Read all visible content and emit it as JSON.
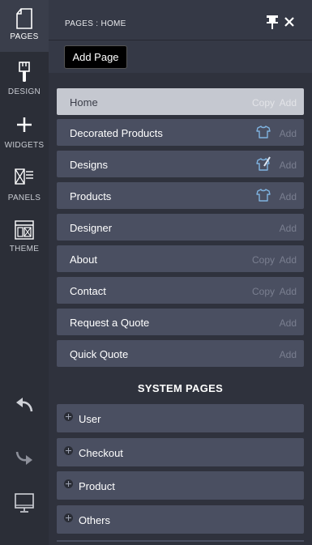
{
  "rail": {
    "items": [
      {
        "label": "PAGES",
        "icon": "page-icon"
      },
      {
        "label": "DESIGN",
        "icon": "brush-icon"
      },
      {
        "label": "WIDGETS",
        "icon": "plus-icon"
      },
      {
        "label": "PANELS",
        "icon": "panels-icon"
      },
      {
        "label": "THEME",
        "icon": "theme-icon"
      }
    ],
    "bottom": [
      "undo-icon",
      "redo-icon",
      "monitor-icon"
    ]
  },
  "panel": {
    "title": "PAGES : HOME",
    "add_page_label": "Add Page",
    "pages": [
      {
        "name": "Home",
        "copy": "Copy",
        "add": "Add",
        "selected": true
      },
      {
        "name": "Decorated Products",
        "add": "Add",
        "icon": "tshirt-icon"
      },
      {
        "name": "Designs",
        "add": "Add",
        "icon": "tshirt-brush-icon"
      },
      {
        "name": "Products",
        "add": "Add",
        "icon": "tshirt-icon"
      },
      {
        "name": "Designer",
        "add": "Add"
      },
      {
        "name": "About",
        "copy": "Copy",
        "add": "Add"
      },
      {
        "name": "Contact",
        "copy": "Copy",
        "add": "Add"
      },
      {
        "name": "Request a Quote",
        "add": "Add"
      },
      {
        "name": "Quick Quote",
        "add": "Add"
      }
    ],
    "system_title": "SYSTEM PAGES",
    "system_pages": [
      "User",
      "Checkout",
      "Product",
      "Others"
    ]
  },
  "colors": {
    "rail_bg": "#2b2e37",
    "panel_bg": "#2f323d",
    "row_bg": "#4a4f61",
    "selected_row_bg": "#c5c8d0",
    "shirt_icon": "#7fb3e0"
  }
}
